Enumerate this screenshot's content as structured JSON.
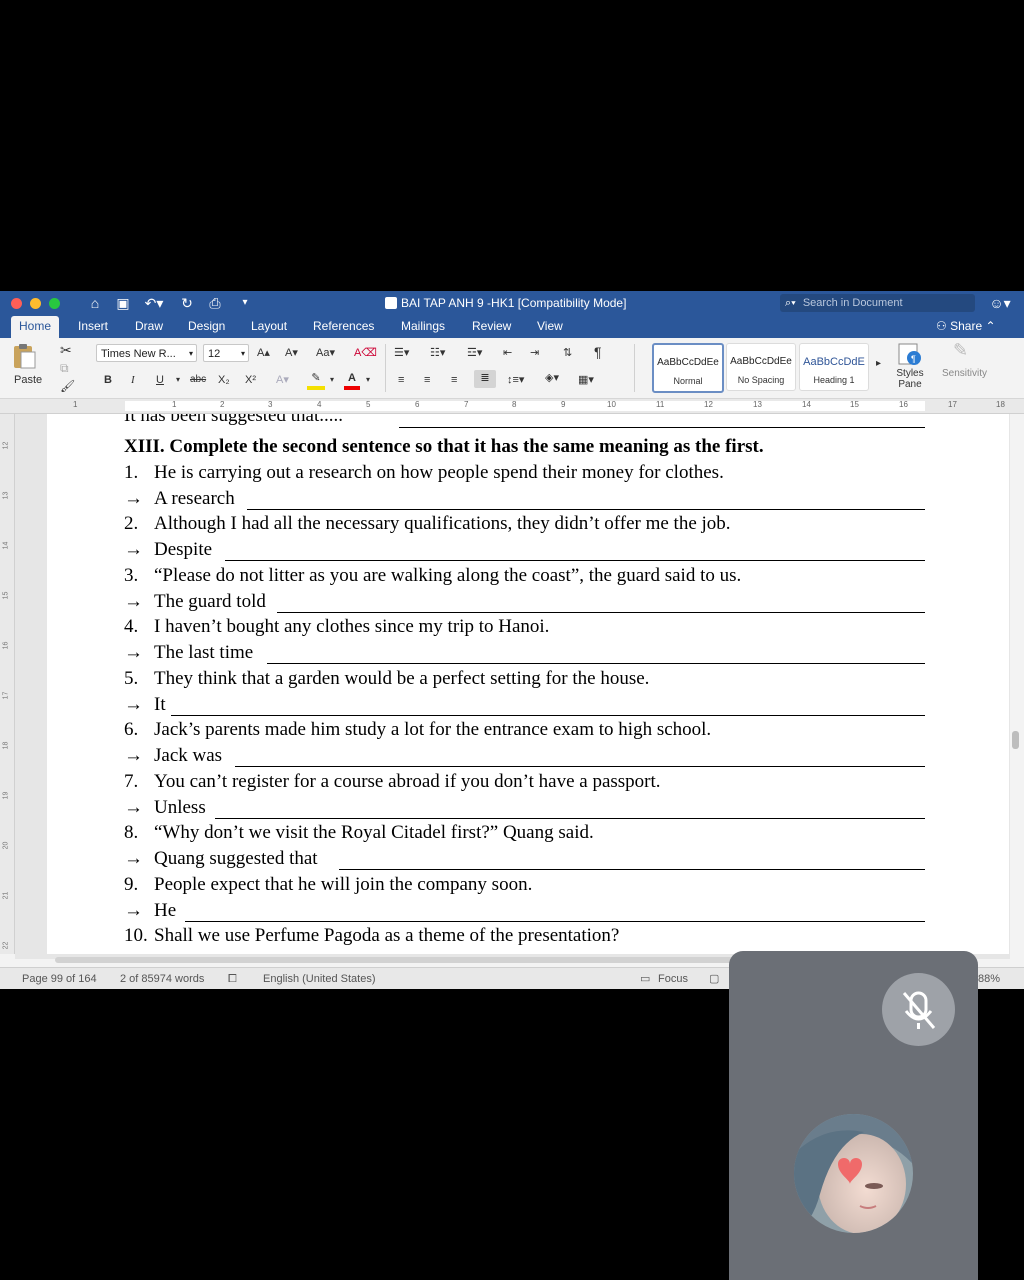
{
  "window": {
    "title": "BAI TAP ANH 9 -HK1 [Compatibility Mode]",
    "search_placeholder": "Search in Document",
    "share_label": "Share"
  },
  "tabs": [
    "Home",
    "Insert",
    "Draw",
    "Design",
    "Layout",
    "References",
    "Mailings",
    "Review",
    "View"
  ],
  "ribbon": {
    "paste_label": "Paste",
    "font_name": "Times New R...",
    "font_size": "12",
    "styles": [
      {
        "preview": "AaBbCcDdEe",
        "name": "Normal"
      },
      {
        "preview": "AaBbCcDdEe",
        "name": "No Spacing"
      },
      {
        "preview": "AaBbCcDdE",
        "name": "Heading 1"
      }
    ],
    "styles_pane_label": "Styles Pane",
    "sensitivity_label": "Sensitivity"
  },
  "ruler_numbers": [
    "1",
    "1",
    "2",
    "3",
    "4",
    "5",
    "6",
    "7",
    "8",
    "9",
    "10",
    "11",
    "12",
    "13",
    "14",
    "15",
    "16",
    "17",
    "18"
  ],
  "vruler_numbers": [
    "12",
    "13",
    "14",
    "15",
    "16",
    "17",
    "18",
    "19",
    "20",
    "21",
    "22"
  ],
  "document": {
    "top_partial": "It has been suggested that.....",
    "heading": "XIII.  Complete the second sentence so that it has the same meaning as the first.",
    "arrow": "→",
    "items": [
      {
        "num": "1.",
        "text": "He is carrying out a research on how people spend their money for clothes.",
        "prompt": "A research"
      },
      {
        "num": "2.",
        "text": "Although I had all the necessary qualifications, they didn’t offer me the job.",
        "prompt": "Despite"
      },
      {
        "num": "3.",
        "text": "“Please do not litter as you are walking along the coast”, the guard said to us.",
        "prompt": "The guard told"
      },
      {
        "num": "4.",
        "text": "I haven’t bought any clothes since my trip to Hanoi.",
        "prompt": "The last time"
      },
      {
        "num": "5.",
        "text": "They think that a garden would be a perfect setting for the house.",
        "prompt": "It"
      },
      {
        "num": "6.",
        "text": "Jack’s parents made him study a lot for the entrance exam to high school.",
        "prompt": "Jack was"
      },
      {
        "num": "7.",
        "text": "You can’t register for a course abroad if you don’t have a passport.",
        "prompt": "Unless"
      },
      {
        "num": "8.",
        "text": "“Why don’t we visit the Royal Citadel first?” Quang said.",
        "prompt": "Quang suggested that"
      },
      {
        "num": "9.",
        "text": "People expect that he will join the company soon.",
        "prompt": "He"
      },
      {
        "num": "10.",
        "text": "Shall we use Perfume Pagoda as a theme of the presentation?",
        "prompt": ""
      }
    ]
  },
  "status": {
    "page": "Page 99 of 164",
    "words": "2 of 85974 words",
    "language": "English (United States)",
    "focus": "Focus",
    "zoom": "88%"
  },
  "colors": {
    "word_blue": "#2b579a",
    "close": "#fe5f57",
    "minimize": "#febc2e",
    "maximize": "#28c840"
  }
}
